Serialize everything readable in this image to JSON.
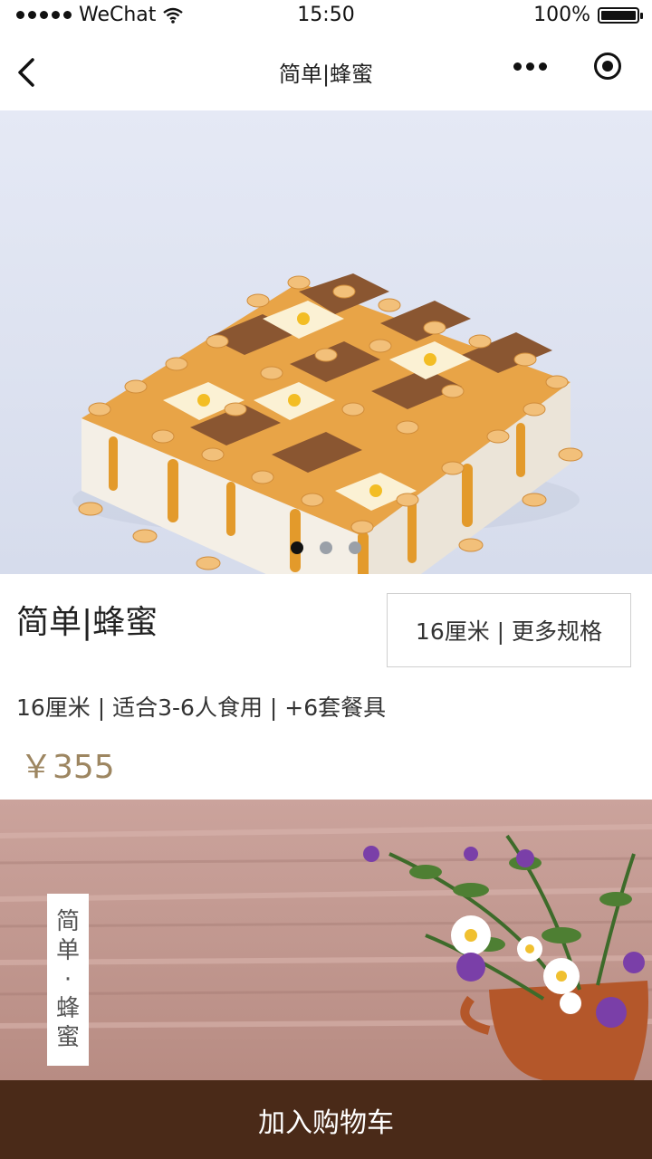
{
  "status_bar": {
    "carrier": "WeChat",
    "time": "15:50",
    "battery": "100%"
  },
  "nav": {
    "title": "简单|蜂蜜"
  },
  "banner": {
    "slides_total": 3,
    "active_slide": 1
  },
  "product": {
    "name": "简单|蜂蜜",
    "spec_button": "16厘米 | 更多规格",
    "description": "16厘米 | 适合3-6人食用 | +6套餐具",
    "price": "￥355"
  },
  "promo": {
    "vertical_label": [
      "简",
      "单",
      "·",
      "蜂",
      "蜜"
    ]
  },
  "footer": {
    "add_to_cart": "加入购物车"
  },
  "colors": {
    "cart_bar": "#4a2a18",
    "price": "#9d8661"
  }
}
